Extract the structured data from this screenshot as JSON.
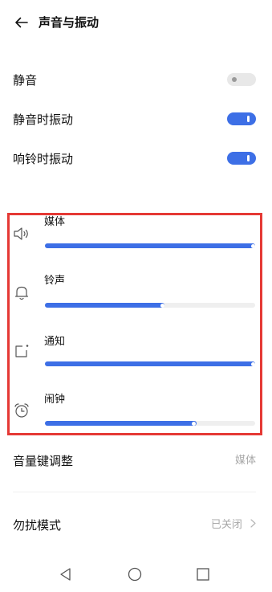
{
  "header": {
    "title": "声音与振动"
  },
  "toggles": [
    {
      "label": "静音",
      "state": "off"
    },
    {
      "label": "静音时振动",
      "state": "on"
    },
    {
      "label": "响铃时振动",
      "state": "on"
    }
  ],
  "volume": {
    "items": [
      {
        "label": "媒体",
        "icon": "speaker-icon",
        "level": 1.0
      },
      {
        "label": "铃声",
        "icon": "bell-icon",
        "level": 0.57
      },
      {
        "label": "通知",
        "icon": "notification-icon",
        "level": 1.0
      },
      {
        "label": "闹钟",
        "icon": "alarm-clock-icon",
        "level": 0.72
      }
    ],
    "highlight_color": "#e53935"
  },
  "volume_keys": {
    "label": "音量键调整",
    "value": "媒体"
  },
  "dnd": {
    "label": "勿扰模式",
    "value": "已关闭"
  },
  "colors": {
    "accent": "#3d6fe6",
    "track": "#efefef",
    "secondary_text": "#a8a8a8"
  },
  "nav": {
    "buttons": [
      "back-nav-icon",
      "home-nav-icon",
      "recents-nav-icon"
    ]
  }
}
